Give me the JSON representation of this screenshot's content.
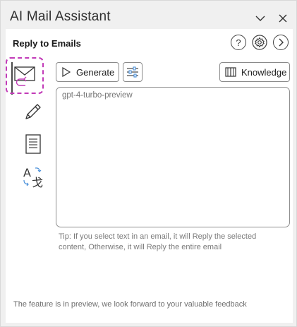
{
  "window": {
    "title": "AI Mail Assistant",
    "collapse_icon": "chevron-down-icon",
    "close_icon": "close-icon"
  },
  "header": {
    "title": "Reply to Emails",
    "help_label": "?",
    "settings_icon": "gear-icon",
    "next_icon": "chevron-right-circle-icon"
  },
  "sidebar": {
    "items": [
      {
        "name": "reply",
        "icon": "mail-reply-icon",
        "active": true
      },
      {
        "name": "compose",
        "icon": "pencil-icon",
        "active": false
      },
      {
        "name": "summarize",
        "icon": "document-icon",
        "active": false
      },
      {
        "name": "translate",
        "icon": "translate-icon",
        "active": false
      }
    ]
  },
  "toolbar": {
    "generate_label": "Generate",
    "settings_icon": "sliders-icon",
    "knowledge_label": "Knowledge"
  },
  "editor": {
    "placeholder": "gpt-4-turbo-preview",
    "value": ""
  },
  "tip_text": "Tip: If you select text in an email, it will Reply the selected content, Otherwise, it will Reply the entire email",
  "footer_text": "The feature is in preview, we look forward to your valuable feedback",
  "colors": {
    "highlight": "#c23bb8",
    "accent_reply": "#4a90d9",
    "background": "#f0f0f0"
  }
}
